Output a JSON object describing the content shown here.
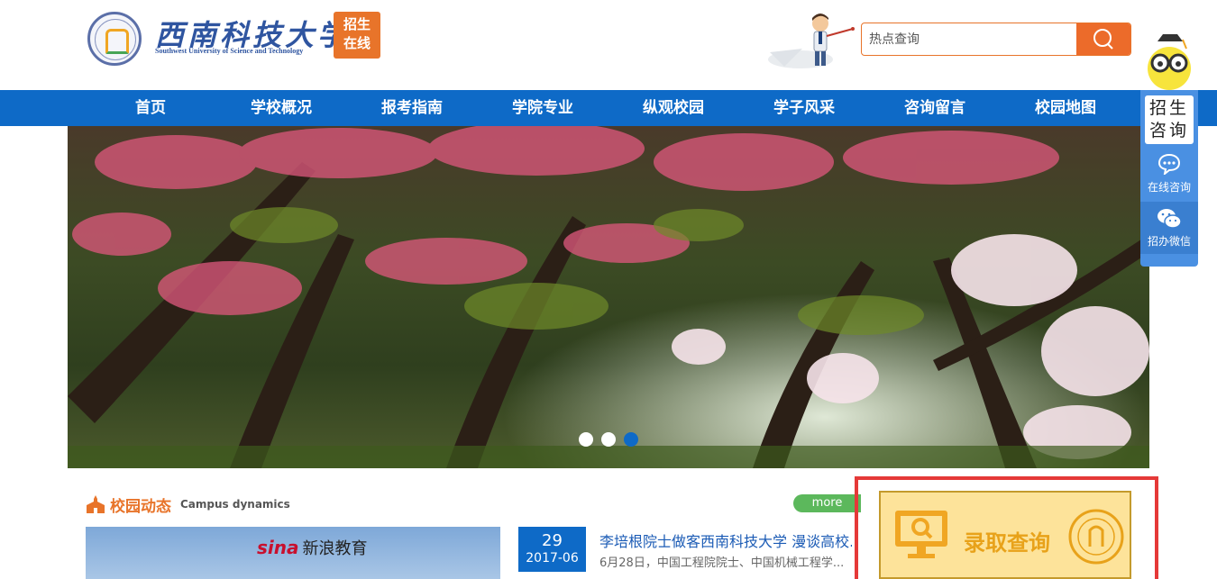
{
  "header": {
    "logo_cn": "西南科技大学",
    "logo_en": "Southwest University of Science and Technology",
    "badge_line1": "招生",
    "badge_line2": "在线"
  },
  "search": {
    "placeholder": "热点查询",
    "icon": "search-icon"
  },
  "nav": {
    "items": [
      "首页",
      "学校概况",
      "报考指南",
      "学院专业",
      "纵观校园",
      "学子风采",
      "咨询留言",
      "校园地图"
    ]
  },
  "banner": {
    "slides": 3,
    "active_index": 2,
    "colors": {
      "dot_active": "#0e6ac7",
      "dot_inactive": "#ffffff"
    }
  },
  "campus": {
    "title_cn": "校园动态",
    "title_en": "Campus dynamics",
    "more": "more",
    "image_caption_brand": "sina",
    "image_caption_text": "新浪教育",
    "news": {
      "day": "29",
      "year_month": "2017-06",
      "title": "李培根院士做客西南科技大学 漫谈高校...",
      "desc": "6月28日，中国工程院院士、中国机械工程学..."
    }
  },
  "admission_query": {
    "label": "录取查询",
    "icon": "monitor-search-icon"
  },
  "sidebar": {
    "title_line1": "招生",
    "title_line2": "咨询",
    "items": [
      {
        "label": "在线咨询",
        "icon": "chat-bubble-icon"
      },
      {
        "label": "招办微信",
        "icon": "wechat-icon"
      }
    ]
  },
  "colors": {
    "primary": "#0e6ac7",
    "accent": "#e8742a",
    "highlight_border": "#e53938",
    "more_green": "#5cb85c"
  }
}
